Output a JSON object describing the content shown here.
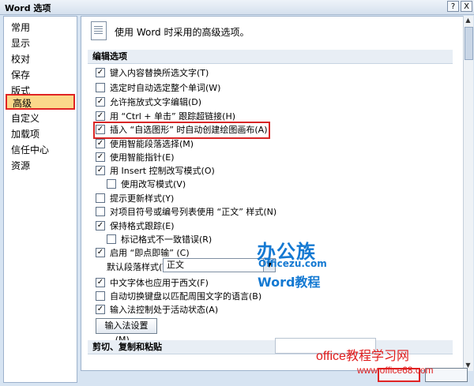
{
  "window": {
    "title": "Word 选项",
    "help": "?",
    "close": "X"
  },
  "sidebar": {
    "items": [
      "常用",
      "显示",
      "校对",
      "保存",
      "版式",
      "高级",
      "自定义",
      "加载项",
      "信任中心",
      "资源"
    ],
    "selected": "高级"
  },
  "header": {
    "text": "使用 Word 时采用的高级选项。"
  },
  "sections": {
    "editing": "编辑选项",
    "clipboard": "剪切、复制和粘贴"
  },
  "options": [
    {
      "label": "键入内容替换所选文字(T)",
      "checked": true
    },
    {
      "label": "选定时自动选定整个单词(W)",
      "checked": false
    },
    {
      "label": "允许拖放式文字编辑(D)",
      "checked": true
    },
    {
      "label": "用 “Ctrl + 单击” 跟踪超链接(H)",
      "checked": true
    },
    {
      "label": "插入 “自选图形” 时自动创建绘图画布(A)",
      "checked": true
    },
    {
      "label": "使用智能段落选择(M)",
      "checked": true
    },
    {
      "label": "使用智能指针(E)",
      "checked": true
    },
    {
      "label": "用 Insert 控制改写模式(O)",
      "checked": true
    },
    {
      "label": "使用改写模式(V)",
      "checked": false
    },
    {
      "label": "提示更新样式(Y)",
      "checked": false
    },
    {
      "label": "对项目符号或编号列表使用 “正文” 样式(N)",
      "checked": false
    },
    {
      "label": "保持格式跟踪(E)",
      "checked": true
    },
    {
      "label": "标记格式不一致错误(R)",
      "checked": false
    },
    {
      "label": "启用 “即点即输” (C)",
      "checked": true
    },
    {
      "label": "中文字体也应用于西文(F)",
      "checked": true
    },
    {
      "label": "自动切换键盘以匹配周围文字的语言(B)",
      "checked": false
    },
    {
      "label": "输入法控制处于活动状态(A)",
      "checked": true
    }
  ],
  "combo": {
    "label": "默认段落样式(Y):",
    "value": "正文"
  },
  "ime_button": "输入法设置(M)...",
  "watermark": {
    "logo_big": "办公族",
    "logo_url": "Officezu.com",
    "logo_sub": "Word教程",
    "text1": "office教程学习网",
    "text2": "www.office68.com"
  },
  "colors": {
    "highlight": "#e02424",
    "selected_bg": "#fbd88a",
    "watermark_blue": "#1479d2"
  }
}
